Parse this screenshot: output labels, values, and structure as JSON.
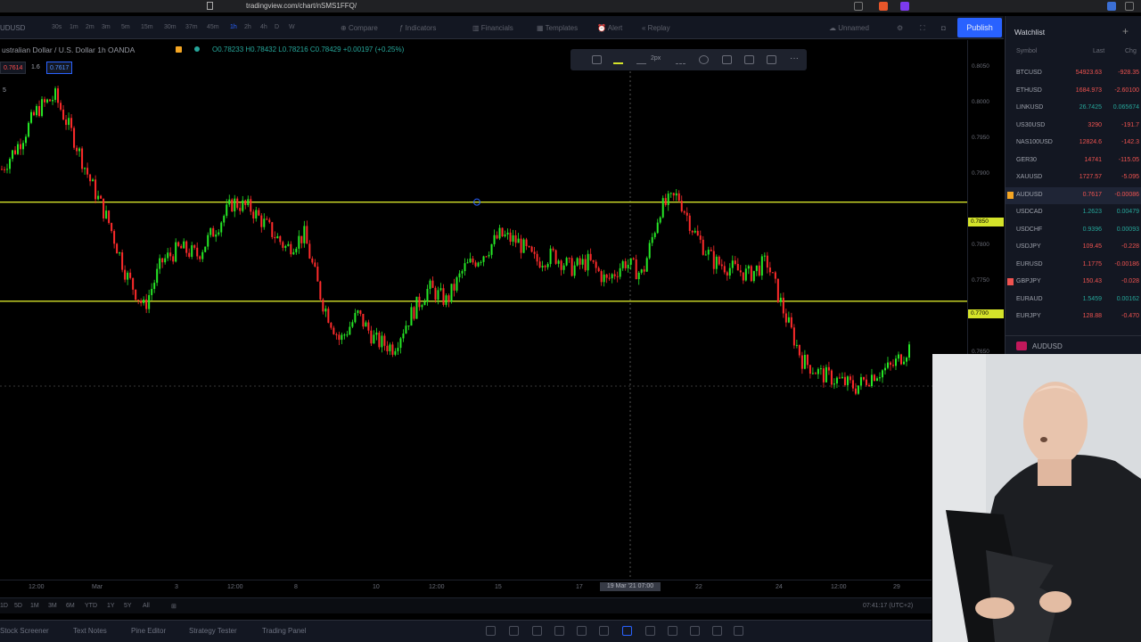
{
  "browser": {
    "url": "tradingview.com/chart/nSMS1FFQ/"
  },
  "toolbar": {
    "symbol": "UDUSD",
    "intervals": [
      "30s",
      "1m",
      "2m",
      "3m",
      "5m",
      "15m",
      "30m",
      "37m",
      "45m",
      "1h",
      "2h",
      "4h",
      "D",
      "W"
    ],
    "compare": "Compare",
    "indicators": "Indicators",
    "financials": "Financials",
    "templates": "Templates",
    "alert": "Alert",
    "replay": "Replay",
    "layout_name": "Unnamed",
    "publish": "Publish"
  },
  "legend": {
    "title": "ustralian Dollar / U.S. Dollar  1h  OANDA",
    "ohlc": "O0.78233  H0.78432  L0.78216  C0.78429  +0.00197 (+0.25%)",
    "badge_sell": "0.7614",
    "badge_spread": "1.6",
    "badge_buy": "0.7617",
    "badge_num": "5"
  },
  "chart_data": {
    "type": "candlestick",
    "title": "",
    "xlabel": "",
    "ylabel": "",
    "x_ticks": [
      "12:00",
      "Mar",
      "3",
      "12:00",
      "8",
      "10",
      "12:00",
      "15",
      "17",
      "19 Mar '21 07:00",
      "22",
      "24",
      "12:00",
      "29"
    ],
    "y_ticks": [
      "0.8050",
      "0.8000",
      "0.7950",
      "0.7900",
      "0.7850",
      "0.7800",
      "0.7750",
      "0.7700",
      "0.7650"
    ],
    "horizontal_levels": [
      {
        "label": "0.7850",
        "color": "#d4e32a"
      },
      {
        "label": "0.7700",
        "color": "#d4e32a"
      }
    ],
    "up_color": "#26e826",
    "down_color": "#ff2b2b",
    "close_path_y": [
      0.79,
      0.794,
      0.799,
      0.801,
      0.795,
      0.788,
      0.782,
      0.774,
      0.769,
      0.776,
      0.778,
      0.777,
      0.781,
      0.785,
      0.784,
      0.781,
      0.778,
      0.78,
      0.77,
      0.764,
      0.768,
      0.764,
      0.763,
      0.768,
      0.772,
      0.77,
      0.775,
      0.777,
      0.78,
      0.779,
      0.776,
      0.777,
      0.775,
      0.776,
      0.773,
      0.776,
      0.774,
      0.784,
      0.786,
      0.78,
      0.776,
      0.775,
      0.774,
      0.776,
      0.768,
      0.761,
      0.759,
      0.758,
      0.757,
      0.759,
      0.76,
      0.763
    ]
  },
  "watchlist": {
    "title": "Watchlist",
    "columns": [
      "Symbol",
      "Last",
      "Chg"
    ],
    "rows": [
      {
        "symbol": "BTCUSD",
        "last": "54923.63",
        "chg": "-928.35",
        "dir": "down",
        "active": false
      },
      {
        "symbol": "ETHUSD",
        "last": "1684.973",
        "chg": "-2.60100",
        "dir": "down",
        "active": false
      },
      {
        "symbol": "LINKUSD",
        "last": "26.7425",
        "chg": "0.065674",
        "dir": "up",
        "active": false
      },
      {
        "symbol": "US30USD",
        "last": "3290",
        "chg": "-191.7",
        "dir": "down",
        "active": false
      },
      {
        "symbol": "NAS100USD",
        "last": "12824.6",
        "chg": "-142.3",
        "dir": "down",
        "active": false
      },
      {
        "symbol": "GER30",
        "last": "14741",
        "chg": "-115.05",
        "dir": "down",
        "active": false
      },
      {
        "symbol": "XAUUSD",
        "last": "1727.57",
        "chg": "-5.095",
        "dir": "down",
        "active": false
      },
      {
        "symbol": "AUDUSD",
        "last": "0.7617",
        "chg": "-0.00086",
        "dir": "down",
        "active": true
      },
      {
        "symbol": "USDCAD",
        "last": "1.2623",
        "chg": "0.00479",
        "dir": "up",
        "active": false
      },
      {
        "symbol": "USDCHF",
        "last": "0.9396",
        "chg": "0.00093",
        "dir": "up",
        "active": false
      },
      {
        "symbol": "USDJPY",
        "last": "109.45",
        "chg": "-0.228",
        "dir": "down",
        "active": false
      },
      {
        "symbol": "EURUSD",
        "last": "1.1775",
        "chg": "-0.00186",
        "dir": "down",
        "active": false
      },
      {
        "symbol": "GBPJPY",
        "last": "150.43",
        "chg": "-0.028",
        "dir": "down",
        "active": false
      },
      {
        "symbol": "EURAUD",
        "last": "1.5459",
        "chg": "0.00162",
        "dir": "up",
        "active": false
      },
      {
        "symbol": "EURJPY",
        "last": "128.88",
        "chg": "-0.470",
        "dir": "down",
        "active": false
      }
    ],
    "footer_symbol": "AUDUSD"
  },
  "time_cursor": "19 Mar '21  07:00",
  "range_bar": {
    "items": [
      "1D",
      "5D",
      "1M",
      "3M",
      "6M",
      "YTD",
      "1Y",
      "5Y",
      "All"
    ],
    "clock": "07:41:17 (UTC+2)"
  },
  "bottom_bar": {
    "tabs": [
      "Stock Screener",
      "Text Notes",
      "Pine Editor",
      "Strategy Tester",
      "Trading Panel"
    ]
  },
  "colors": {
    "accent": "#2962ff",
    "level_line": "#d4e32a",
    "up": "#26e826",
    "down": "#ff2b2b"
  }
}
